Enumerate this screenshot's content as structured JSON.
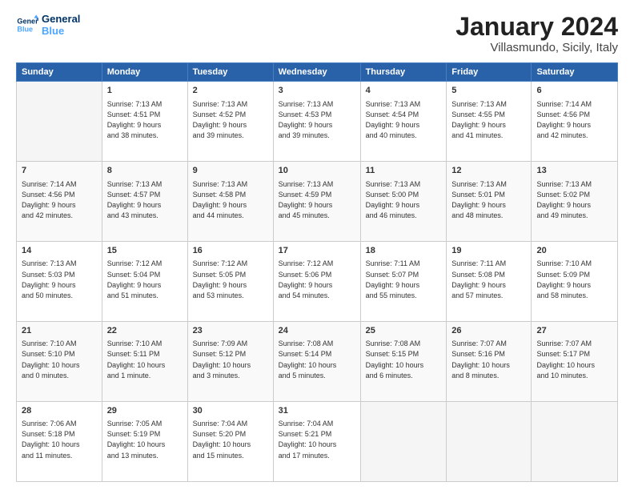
{
  "logo": {
    "line1": "General",
    "line2": "Blue"
  },
  "title": "January 2024",
  "subtitle": "Villasmundo, Sicily, Italy",
  "days_of_week": [
    "Sunday",
    "Monday",
    "Tuesday",
    "Wednesday",
    "Thursday",
    "Friday",
    "Saturday"
  ],
  "weeks": [
    [
      {
        "day": "",
        "info": ""
      },
      {
        "day": "1",
        "info": "Sunrise: 7:13 AM\nSunset: 4:51 PM\nDaylight: 9 hours\nand 38 minutes."
      },
      {
        "day": "2",
        "info": "Sunrise: 7:13 AM\nSunset: 4:52 PM\nDaylight: 9 hours\nand 39 minutes."
      },
      {
        "day": "3",
        "info": "Sunrise: 7:13 AM\nSunset: 4:53 PM\nDaylight: 9 hours\nand 39 minutes."
      },
      {
        "day": "4",
        "info": "Sunrise: 7:13 AM\nSunset: 4:54 PM\nDaylight: 9 hours\nand 40 minutes."
      },
      {
        "day": "5",
        "info": "Sunrise: 7:13 AM\nSunset: 4:55 PM\nDaylight: 9 hours\nand 41 minutes."
      },
      {
        "day": "6",
        "info": "Sunrise: 7:14 AM\nSunset: 4:56 PM\nDaylight: 9 hours\nand 42 minutes."
      }
    ],
    [
      {
        "day": "7",
        "info": "Sunrise: 7:14 AM\nSunset: 4:56 PM\nDaylight: 9 hours\nand 42 minutes."
      },
      {
        "day": "8",
        "info": "Sunrise: 7:13 AM\nSunset: 4:57 PM\nDaylight: 9 hours\nand 43 minutes."
      },
      {
        "day": "9",
        "info": "Sunrise: 7:13 AM\nSunset: 4:58 PM\nDaylight: 9 hours\nand 44 minutes."
      },
      {
        "day": "10",
        "info": "Sunrise: 7:13 AM\nSunset: 4:59 PM\nDaylight: 9 hours\nand 45 minutes."
      },
      {
        "day": "11",
        "info": "Sunrise: 7:13 AM\nSunset: 5:00 PM\nDaylight: 9 hours\nand 46 minutes."
      },
      {
        "day": "12",
        "info": "Sunrise: 7:13 AM\nSunset: 5:01 PM\nDaylight: 9 hours\nand 48 minutes."
      },
      {
        "day": "13",
        "info": "Sunrise: 7:13 AM\nSunset: 5:02 PM\nDaylight: 9 hours\nand 49 minutes."
      }
    ],
    [
      {
        "day": "14",
        "info": "Sunrise: 7:13 AM\nSunset: 5:03 PM\nDaylight: 9 hours\nand 50 minutes."
      },
      {
        "day": "15",
        "info": "Sunrise: 7:12 AM\nSunset: 5:04 PM\nDaylight: 9 hours\nand 51 minutes."
      },
      {
        "day": "16",
        "info": "Sunrise: 7:12 AM\nSunset: 5:05 PM\nDaylight: 9 hours\nand 53 minutes."
      },
      {
        "day": "17",
        "info": "Sunrise: 7:12 AM\nSunset: 5:06 PM\nDaylight: 9 hours\nand 54 minutes."
      },
      {
        "day": "18",
        "info": "Sunrise: 7:11 AM\nSunset: 5:07 PM\nDaylight: 9 hours\nand 55 minutes."
      },
      {
        "day": "19",
        "info": "Sunrise: 7:11 AM\nSunset: 5:08 PM\nDaylight: 9 hours\nand 57 minutes."
      },
      {
        "day": "20",
        "info": "Sunrise: 7:10 AM\nSunset: 5:09 PM\nDaylight: 9 hours\nand 58 minutes."
      }
    ],
    [
      {
        "day": "21",
        "info": "Sunrise: 7:10 AM\nSunset: 5:10 PM\nDaylight: 10 hours\nand 0 minutes."
      },
      {
        "day": "22",
        "info": "Sunrise: 7:10 AM\nSunset: 5:11 PM\nDaylight: 10 hours\nand 1 minute."
      },
      {
        "day": "23",
        "info": "Sunrise: 7:09 AM\nSunset: 5:12 PM\nDaylight: 10 hours\nand 3 minutes."
      },
      {
        "day": "24",
        "info": "Sunrise: 7:08 AM\nSunset: 5:14 PM\nDaylight: 10 hours\nand 5 minutes."
      },
      {
        "day": "25",
        "info": "Sunrise: 7:08 AM\nSunset: 5:15 PM\nDaylight: 10 hours\nand 6 minutes."
      },
      {
        "day": "26",
        "info": "Sunrise: 7:07 AM\nSunset: 5:16 PM\nDaylight: 10 hours\nand 8 minutes."
      },
      {
        "day": "27",
        "info": "Sunrise: 7:07 AM\nSunset: 5:17 PM\nDaylight: 10 hours\nand 10 minutes."
      }
    ],
    [
      {
        "day": "28",
        "info": "Sunrise: 7:06 AM\nSunset: 5:18 PM\nDaylight: 10 hours\nand 11 minutes."
      },
      {
        "day": "29",
        "info": "Sunrise: 7:05 AM\nSunset: 5:19 PM\nDaylight: 10 hours\nand 13 minutes."
      },
      {
        "day": "30",
        "info": "Sunrise: 7:04 AM\nSunset: 5:20 PM\nDaylight: 10 hours\nand 15 minutes."
      },
      {
        "day": "31",
        "info": "Sunrise: 7:04 AM\nSunset: 5:21 PM\nDaylight: 10 hours\nand 17 minutes."
      },
      {
        "day": "",
        "info": ""
      },
      {
        "day": "",
        "info": ""
      },
      {
        "day": "",
        "info": ""
      }
    ]
  ]
}
